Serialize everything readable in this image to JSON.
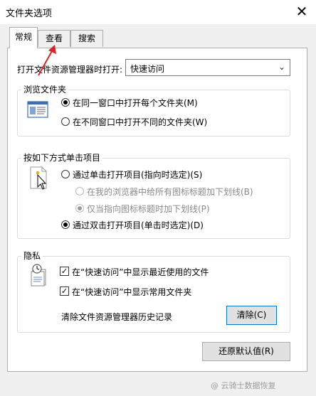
{
  "window": {
    "title": "文件夹选项",
    "close_glyph": "✕"
  },
  "tabs": [
    {
      "label": "常规",
      "active": true
    },
    {
      "label": "查看",
      "active": false
    },
    {
      "label": "搜索",
      "active": false
    }
  ],
  "open_explorer": {
    "label": "打开文件资源管理器时打开:",
    "value": "快速访问"
  },
  "browse": {
    "title": "浏览文件夹",
    "options": [
      {
        "label": "在同一窗口中打开每个文件夹(M)",
        "checked": true
      },
      {
        "label": "在不同窗口中打开不同的文件夹(W)",
        "checked": false
      }
    ]
  },
  "click": {
    "title": "按如下方式单击项目",
    "single_click": "通过单击打开项目(指向时选定)(S)",
    "underline_all": "在我的浏览器中给所有图标标题加下划线(B)",
    "underline_point": "仅当指向图标标题时加下划线(P)",
    "double_click": "通过双击打开项目(单击时选定)(D)"
  },
  "privacy": {
    "title": "隐私",
    "recent_files": "在“快速访问”中显示最近使用的文件",
    "frequent_folders": "在“快速访问”中显示常用文件夹",
    "clear_history_label": "清除文件资源管理器历史记录",
    "clear_button": "清除(C)"
  },
  "restore_defaults": "还原默认值(R)",
  "watermark": "@ 云骑士数据恢复",
  "colors": {
    "accent": "#0078d7",
    "annotation_arrow": "#d9252a"
  }
}
